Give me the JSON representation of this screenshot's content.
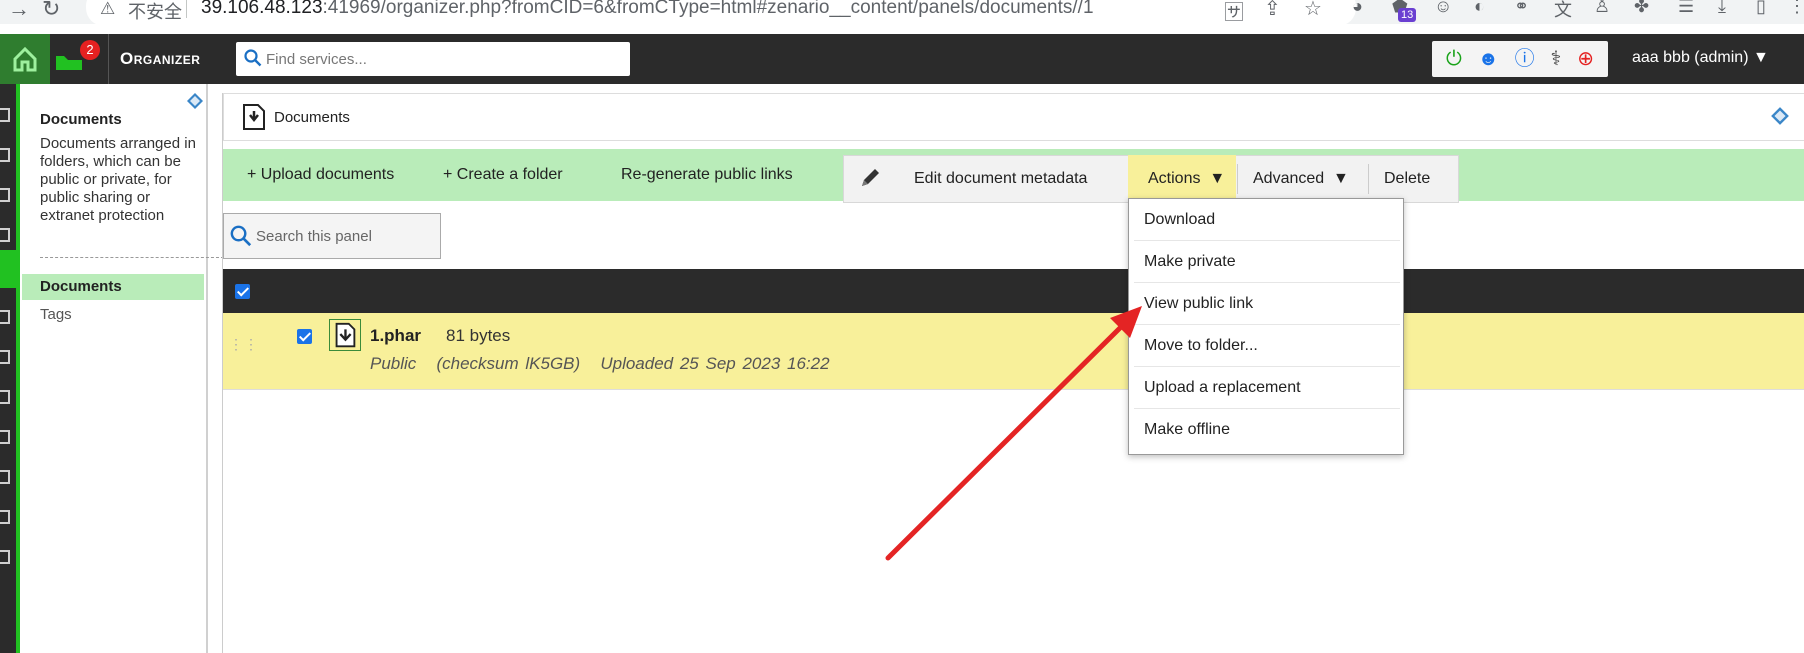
{
  "browser": {
    "insecure_label": "不安全",
    "url_host": "39.106.48.123",
    "url_rest": ":41969/organizer.php?fromCID=6&fromCType=html#zenario__content/panels/documents//1",
    "extension_badge": "13"
  },
  "topbar": {
    "brand": "Organizer",
    "notification_count": "2",
    "search_placeholder": "Find services...",
    "user_label": "aaa bbb (admin) ▼"
  },
  "nav": {
    "heading": "Documents",
    "description": "Documents arranged in folders, which can be public or private, for public sharing or extranet protection",
    "items": [
      {
        "label": "Documents",
        "selected": true
      },
      {
        "label": "Tags",
        "selected": false
      }
    ]
  },
  "panel": {
    "title": "Documents",
    "search_placeholder": "Search this panel"
  },
  "toolbar": {
    "upload": "+ Upload documents",
    "create_folder": "+ Create a folder",
    "regenerate": "Re-generate public links",
    "edit_metadata": "Edit document metadata",
    "actions": "Actions  ▼",
    "advanced": "Advanced  ▼",
    "delete": "Delete"
  },
  "rows": [
    {
      "name": "1.phar",
      "size": "81 bytes",
      "meta": "Public   (checksum lK5GB)   Uploaded 25 Sep 2023 16:22",
      "checked": true
    }
  ],
  "actions_menu": [
    "Download",
    "Make private",
    "View public link",
    "Move to folder...",
    "Upload a replacement",
    "Make offline"
  ],
  "colors": {
    "toolbar_green": "#b9ecb9",
    "row_yellow": "#f8f09a",
    "actions_highlight": "#f8f09a",
    "dark_bar": "#2b2b2b",
    "annotation_arrow": "#e42424"
  }
}
